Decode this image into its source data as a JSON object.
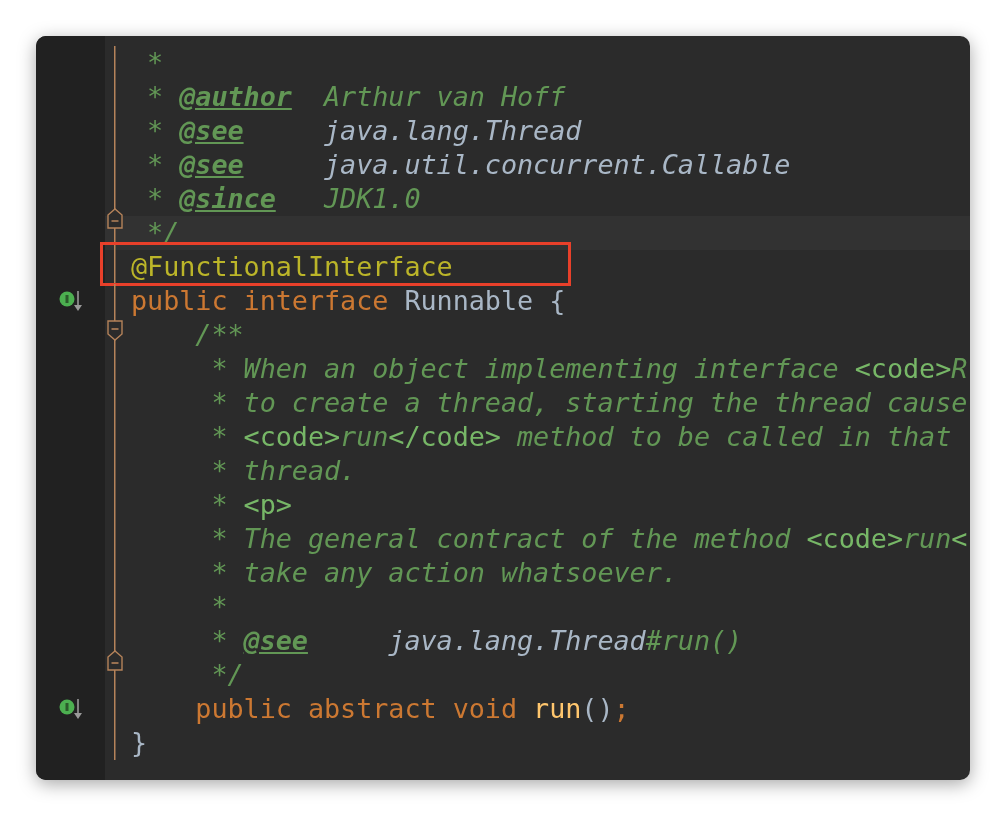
{
  "editor": {
    "lines": [
      {
        "segments": [
          {
            "kind": "comment",
            "text": " *"
          }
        ]
      },
      {
        "segments": [
          {
            "kind": "comment",
            "text": " * "
          },
          {
            "kind": "doc-tag",
            "text": "@author"
          },
          {
            "kind": "comment",
            "text": "  Arthur van Hoff"
          }
        ]
      },
      {
        "segments": [
          {
            "kind": "comment",
            "text": " * "
          },
          {
            "kind": "doc-tag",
            "text": "@see"
          },
          {
            "kind": "doc-ref",
            "text": "     java.lang.Thread"
          }
        ]
      },
      {
        "segments": [
          {
            "kind": "comment",
            "text": " * "
          },
          {
            "kind": "doc-tag",
            "text": "@see"
          },
          {
            "kind": "doc-ref",
            "text": "     java.util.concurrent.Callable"
          }
        ]
      },
      {
        "segments": [
          {
            "kind": "comment",
            "text": " * "
          },
          {
            "kind": "doc-tag",
            "text": "@since"
          },
          {
            "kind": "comment",
            "text": "   JDK1.0"
          }
        ]
      },
      {
        "current": true,
        "fold_end": true,
        "segments": [
          {
            "kind": "comment",
            "text": " */"
          }
        ]
      },
      {
        "highlighted": true,
        "segments": [
          {
            "kind": "annotation",
            "text": "@FunctionalInterface"
          }
        ]
      },
      {
        "implemented": true,
        "segments": [
          {
            "kind": "keyword",
            "text": "public interface "
          },
          {
            "kind": "type",
            "text": "Runnable {"
          }
        ]
      },
      {
        "fold_start": true,
        "segments": [
          {
            "kind": "comment",
            "text": "    /**"
          }
        ]
      },
      {
        "segments": [
          {
            "kind": "comment",
            "text": "     * When an object implementing interface "
          },
          {
            "kind": "html-tag",
            "text": "<code>"
          },
          {
            "kind": "comment",
            "text": "R"
          }
        ]
      },
      {
        "segments": [
          {
            "kind": "comment",
            "text": "     * to create a thread, starting the thread cause"
          }
        ]
      },
      {
        "segments": [
          {
            "kind": "comment",
            "text": "     * "
          },
          {
            "kind": "html-tag",
            "text": "<code>"
          },
          {
            "kind": "comment",
            "text": "run"
          },
          {
            "kind": "html-tag",
            "text": "</code>"
          },
          {
            "kind": "comment",
            "text": " method to be called in that"
          }
        ]
      },
      {
        "segments": [
          {
            "kind": "comment",
            "text": "     * thread."
          }
        ]
      },
      {
        "segments": [
          {
            "kind": "comment",
            "text": "     * "
          },
          {
            "kind": "html-tag",
            "text": "<p>"
          }
        ]
      },
      {
        "segments": [
          {
            "kind": "comment",
            "text": "     * The general contract of the method "
          },
          {
            "kind": "html-tag",
            "text": "<code>"
          },
          {
            "kind": "comment",
            "text": "run"
          },
          {
            "kind": "html-tag",
            "text": "<"
          }
        ]
      },
      {
        "segments": [
          {
            "kind": "comment",
            "text": "     * take any action whatsoever."
          }
        ]
      },
      {
        "segments": [
          {
            "kind": "comment",
            "text": "     *"
          }
        ]
      },
      {
        "segments": [
          {
            "kind": "comment",
            "text": "     * "
          },
          {
            "kind": "doc-tag",
            "text": "@see"
          },
          {
            "kind": "doc-ref",
            "text": "     java.lang.Thread"
          },
          {
            "kind": "comment",
            "text": "#run()"
          }
        ]
      },
      {
        "fold_end": true,
        "segments": [
          {
            "kind": "comment",
            "text": "     */"
          }
        ]
      },
      {
        "implemented": true,
        "segments": [
          {
            "kind": "keyword",
            "text": "    public abstract void "
          },
          {
            "kind": "method",
            "text": "run"
          },
          {
            "kind": "type",
            "text": "()"
          },
          {
            "kind": "keyword",
            "text": ";"
          }
        ]
      },
      {
        "segments": [
          {
            "kind": "type",
            "text": "}"
          }
        ]
      }
    ]
  }
}
